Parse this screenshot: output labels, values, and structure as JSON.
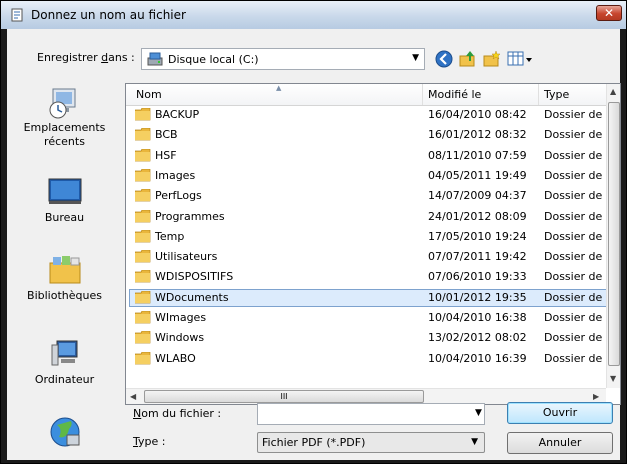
{
  "window": {
    "title": "Donnez un nom au fichier",
    "close_glyph": "✕"
  },
  "toolbar": {
    "save_in_label": "Enregistrer dans :",
    "save_in_value": "Disque local (C:)",
    "icons": [
      "back-arrow-icon",
      "up-folder-icon",
      "new-folder-icon",
      "view-menu-icon"
    ]
  },
  "places": [
    {
      "label": "Emplacements récents",
      "icon": "recent-places-icon"
    },
    {
      "label": "Bureau",
      "icon": "desktop-icon"
    },
    {
      "label": "Bibliothèques",
      "icon": "libraries-icon"
    },
    {
      "label": "Ordinateur",
      "icon": "computer-icon"
    },
    {
      "label": "",
      "icon": "network-icon"
    }
  ],
  "columns": {
    "name": "Nom",
    "modified": "Modifié le",
    "type": "Type"
  },
  "files": [
    {
      "name": "BACKUP",
      "modified": "16/04/2010 08:42",
      "type": "Dossier de fichiers"
    },
    {
      "name": "BCB",
      "modified": "16/01/2012 08:32",
      "type": "Dossier de fichiers"
    },
    {
      "name": "HSF",
      "modified": "08/11/2010 07:59",
      "type": "Dossier de fichiers"
    },
    {
      "name": "Images",
      "modified": "04/05/2011 19:49",
      "type": "Dossier de fichiers"
    },
    {
      "name": "PerfLogs",
      "modified": "14/07/2009 04:37",
      "type": "Dossier de fichiers"
    },
    {
      "name": "Programmes",
      "modified": "24/01/2012 08:09",
      "type": "Dossier de fichiers"
    },
    {
      "name": "Temp",
      "modified": "17/05/2010 19:24",
      "type": "Dossier de fichiers"
    },
    {
      "name": "Utilisateurs",
      "modified": "07/07/2011 19:42",
      "type": "Dossier de fichiers"
    },
    {
      "name": "WDISPOSITIFS",
      "modified": "07/06/2010 19:33",
      "type": "Dossier de fichiers"
    },
    {
      "name": "WDocuments",
      "modified": "10/01/2012 19:35",
      "type": "Dossier de fichiers",
      "selected": true
    },
    {
      "name": "WImages",
      "modified": "10/04/2010 16:38",
      "type": "Dossier de fichiers"
    },
    {
      "name": "Windows",
      "modified": "13/02/2012 08:02",
      "type": "Dossier de fichiers"
    },
    {
      "name": "WLABO",
      "modified": "10/04/2010 16:39",
      "type": "Dossier de fichiers"
    }
  ],
  "filename": {
    "label": "Nom du fichier :",
    "value": ""
  },
  "filetype": {
    "label": "Type :",
    "value": "Fichier PDF (*.PDF)"
  },
  "buttons": {
    "open": "Ouvrir",
    "cancel": "Annuler"
  },
  "scroll_grip": "III"
}
